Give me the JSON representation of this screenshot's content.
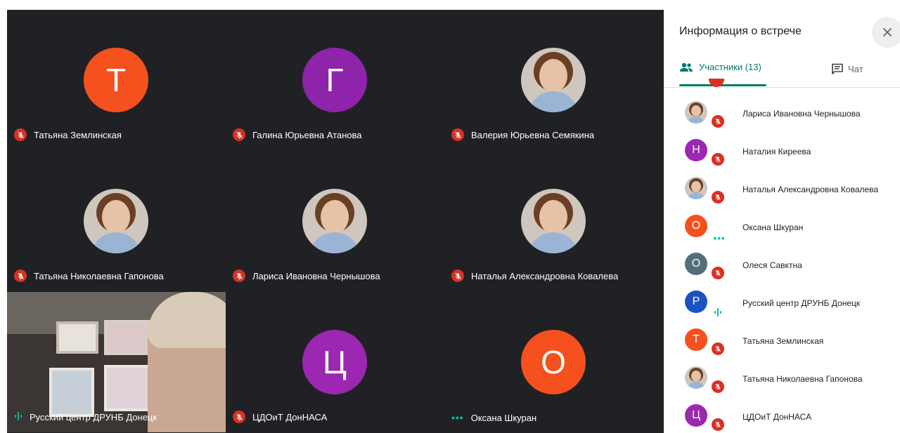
{
  "sidebar": {
    "title": "Информация о встрече",
    "tabs": {
      "people": "Участники (13)",
      "chat": "Чат"
    },
    "participants": [
      {
        "name": "Лариса Ивановна Чернышова",
        "initial": "",
        "color": "#cfc7bd",
        "photo": true,
        "status": "muted"
      },
      {
        "name": "Наталия Киреева",
        "initial": "Н",
        "color": "#9c27b0",
        "photo": false,
        "status": "muted"
      },
      {
        "name": "Наталья Александровна Ковалева",
        "initial": "",
        "color": "#cfc7bd",
        "photo": true,
        "status": "muted"
      },
      {
        "name": "Оксана Шкуран",
        "initial": "О",
        "color": "#f4511e",
        "photo": false,
        "status": "dots"
      },
      {
        "name": "Олеся Савктна",
        "initial": "О",
        "color": "#546e7a",
        "photo": false,
        "status": "muted"
      },
      {
        "name": "Русский центр ДРУНБ Донецк",
        "initial": "Р",
        "color": "#1a52c4",
        "photo": false,
        "status": "speaking"
      },
      {
        "name": "Татьяна Землинская",
        "initial": "Т",
        "color": "#f4511e",
        "photo": false,
        "status": "muted"
      },
      {
        "name": "Татьяна Николаевна Гапонова",
        "initial": "",
        "color": "#cfc7bd",
        "photo": true,
        "status": "muted"
      },
      {
        "name": "ЦДОиТ ДонНАСА",
        "initial": "Ц",
        "color": "#9c27b0",
        "photo": false,
        "status": "muted"
      }
    ]
  },
  "grid": {
    "tiles": [
      {
        "name": "Татьяна Землинская",
        "initial": "Т",
        "color": "#f4511e",
        "photo": false,
        "status": "muted"
      },
      {
        "name": "Галина Юрьевна Атанова",
        "initial": "Г",
        "color": "#8e24aa",
        "photo": false,
        "status": "muted"
      },
      {
        "name": "Валерия Юрьевна Семякина",
        "initial": "",
        "color": "#cfc7bd",
        "photo": true,
        "status": "muted"
      },
      {
        "name": "Татьяна Николаевна Гапонова",
        "initial": "",
        "color": "#cfc7bd",
        "photo": true,
        "status": "muted"
      },
      {
        "name": "Лариса Ивановна Чернышова",
        "initial": "",
        "color": "#cfc7bd",
        "photo": true,
        "status": "muted"
      },
      {
        "name": "Наталья Александровна Ковалева",
        "initial": "",
        "color": "#cfc7bd",
        "photo": true,
        "status": "muted"
      },
      {
        "name": "Русский центр ДРУНБ Донецк",
        "initial": "",
        "color": "#6a665f",
        "photo": false,
        "status": "speaking",
        "video": true
      },
      {
        "name": "ЦДОиТ ДонНАСА",
        "initial": "Ц",
        "color": "#9c27b0",
        "photo": false,
        "status": "muted"
      },
      {
        "name": "Оксана Шкуран",
        "initial": "О",
        "color": "#f4511e",
        "photo": false,
        "status": "dots"
      }
    ]
  },
  "colors": {
    "accent": "#00796b",
    "muted_badge": "#d93025",
    "speaking": "#00bfa5",
    "grid_bg": "#202124"
  },
  "icons": {
    "close": "close-icon",
    "people": "people-icon",
    "chat": "chat-icon",
    "mic_off": "mic-off-icon",
    "more": "more-dots-icon",
    "speaking": "audio-level-icon"
  }
}
